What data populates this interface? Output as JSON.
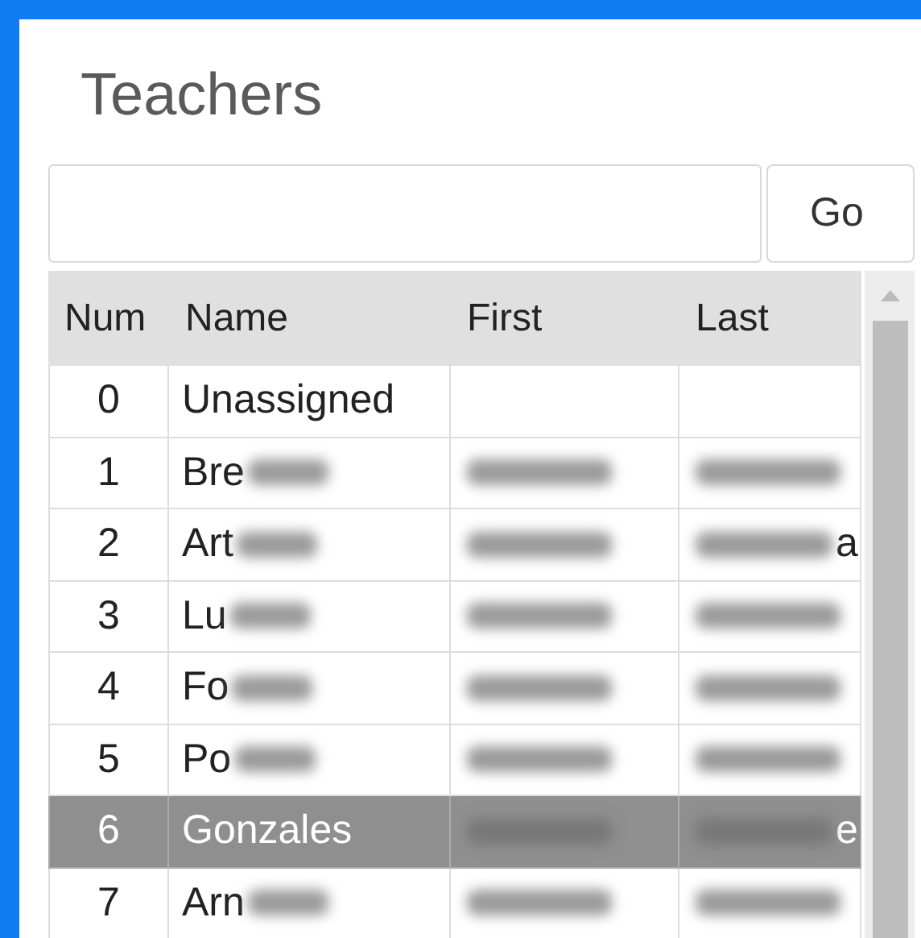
{
  "panel": {
    "title": "Teachers"
  },
  "search": {
    "button": "Go"
  },
  "table": {
    "columns": [
      "Num",
      "Name",
      "First",
      "Last"
    ],
    "rows": [
      {
        "num": "0",
        "name": {
          "text": "Unassigned",
          "blurred": false
        },
        "first": {
          "blurred": false
        },
        "last": {
          "blurred": false
        },
        "selected": false
      },
      {
        "num": "1",
        "name": {
          "text": "Bre",
          "blurred": true
        },
        "first": {
          "blurred": true
        },
        "last": {
          "blurred": true
        },
        "selected": false
      },
      {
        "num": "2",
        "name": {
          "text": "Art",
          "blurred": true
        },
        "first": {
          "blurred": true
        },
        "last": {
          "blurred": true,
          "tail": "a"
        },
        "selected": false
      },
      {
        "num": "3",
        "name": {
          "text": "Lu",
          "blurred": true
        },
        "first": {
          "blurred": true
        },
        "last": {
          "blurred": true
        },
        "selected": false
      },
      {
        "num": "4",
        "name": {
          "text": "Fo",
          "blurred": true
        },
        "first": {
          "blurred": true
        },
        "last": {
          "blurred": true
        },
        "selected": false
      },
      {
        "num": "5",
        "name": {
          "text": "Po",
          "blurred": true
        },
        "first": {
          "blurred": true
        },
        "last": {
          "blurred": true
        },
        "selected": false
      },
      {
        "num": "6",
        "name": {
          "text": "Gonzales",
          "blurred": false
        },
        "first": {
          "blurred": true
        },
        "last": {
          "blurred": true,
          "tail": "e"
        },
        "selected": true
      },
      {
        "num": "7",
        "name": {
          "text": "Arn",
          "blurred": true
        },
        "first": {
          "blurred": true
        },
        "last": {
          "blurred": true
        },
        "selected": false
      }
    ]
  }
}
